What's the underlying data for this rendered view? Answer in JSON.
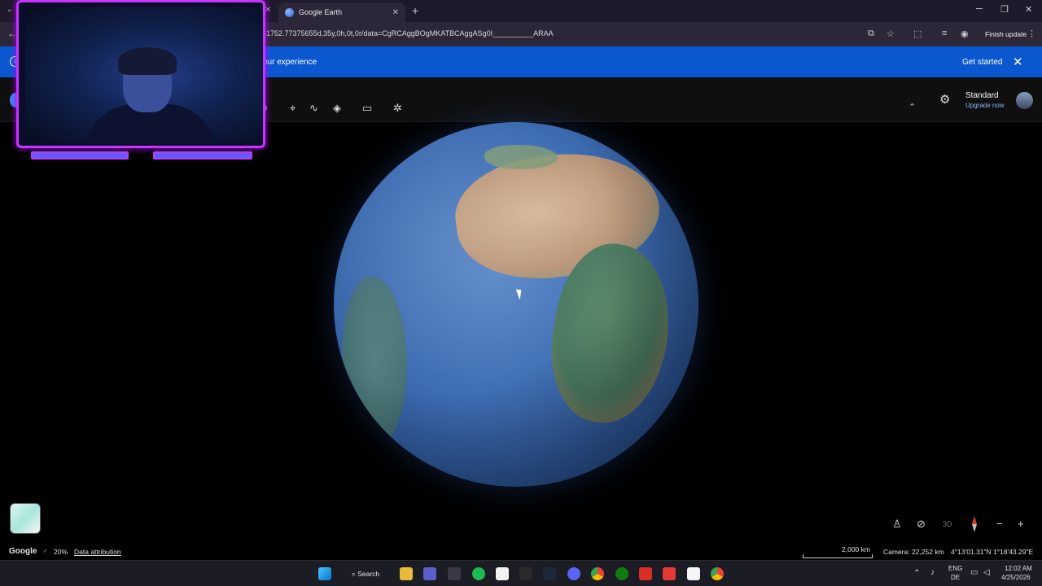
{
  "browser": {
    "tab_title": "Google Earth",
    "url": "51752.77375655d,35y,0h,0t,0r/data=CgRCAggBOgMKATBCAggASg0I__________ARAA",
    "finish_update_label": "Finish update"
  },
  "banner": {
    "message": "our experience",
    "cta_label": "Get started"
  },
  "earth_app": {
    "plan_name": "Standard",
    "upgrade_label": "Upgrade now",
    "tools": [
      "add-place-icon",
      "path-icon",
      "layers-icon",
      "measure-icon",
      "satellite-icon"
    ]
  },
  "map_controls": {
    "mode_3d_label": "3D"
  },
  "status": {
    "brand": "Google",
    "loading_percent": "20%",
    "data_attribution": "Data attribution",
    "scale": "2,000 km",
    "camera": "Camera: 22,252 km",
    "coordinates": "4°13'01.31\"N 1°18'43.29\"E"
  },
  "taskbar": {
    "search_label": "Search",
    "lang_1": "ENG",
    "lang_2": "DE",
    "time": "12:02 AM",
    "date": "4/25/2026"
  },
  "colors": {
    "banner": "#0b57d0",
    "webcam_frame": "#c733ff",
    "link": "#8ab4f8"
  }
}
